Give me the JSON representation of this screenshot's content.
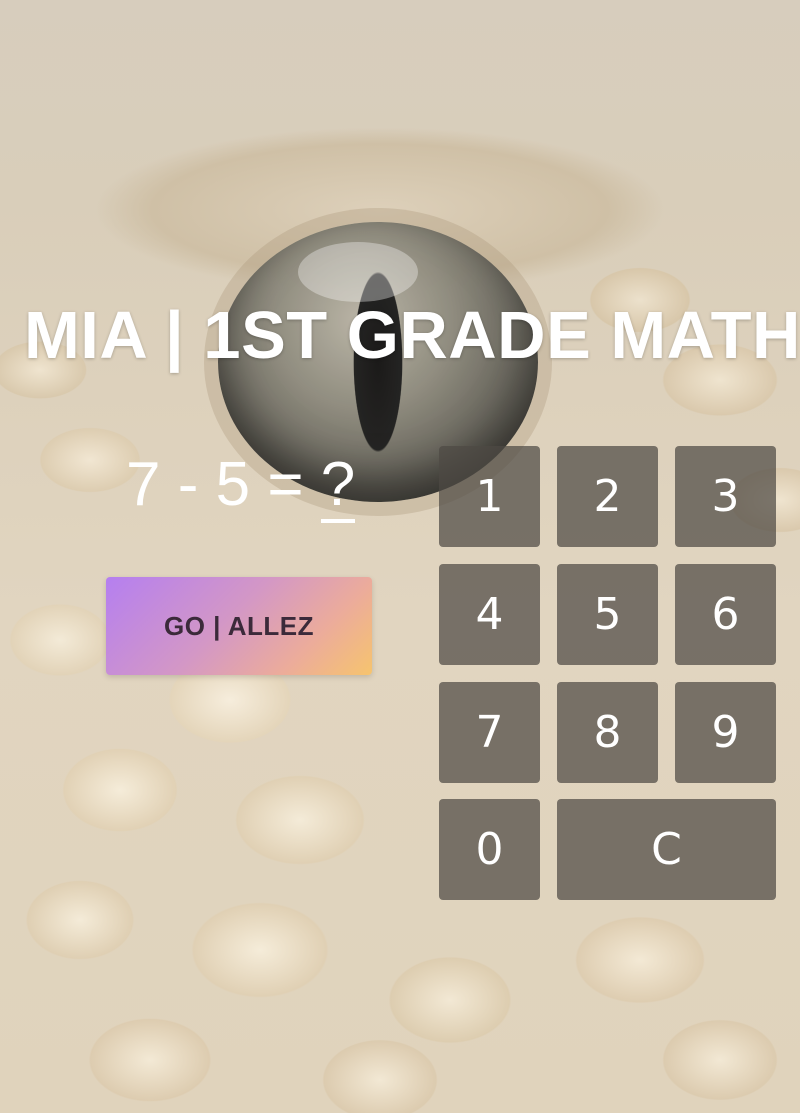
{
  "header": {
    "title": "MIA | 1ST GRADE MATH"
  },
  "problem": {
    "left": "7",
    "operator": "-",
    "right": "5",
    "equals": "=",
    "answer_placeholder": "?"
  },
  "go_button": {
    "label": "GO | ALLEZ"
  },
  "keypad": {
    "keys": [
      "1",
      "2",
      "3",
      "4",
      "5",
      "6",
      "7",
      "8",
      "9",
      "0",
      "C"
    ]
  },
  "colors": {
    "go_gradient_start": "#b57ff0",
    "go_gradient_end": "#f6c46e",
    "key_background": "#4e4a44",
    "text": "#ffffff"
  }
}
